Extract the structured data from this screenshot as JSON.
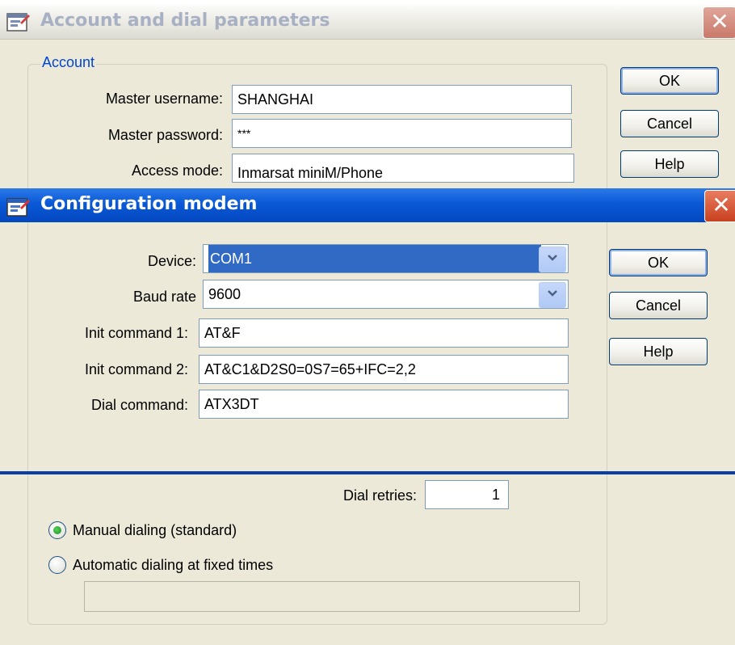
{
  "account_dialog": {
    "title": "Account and dial parameters",
    "close_glyph": "✕",
    "group_title": "Account",
    "master_username_label": "Master username:",
    "master_username_value": "SHANGHAI",
    "master_password_label": "Master password:",
    "master_password_value": "***",
    "access_mode_label": "Access mode:",
    "access_mode_value": "Inmarsat miniM/Phone",
    "ok_label": "OK",
    "cancel_label": "Cancel",
    "help_label": "Help",
    "dial_retries_label": "Dial retries:",
    "dial_retries_value": "1",
    "manual_dialing_label": "Manual dialing (standard)",
    "manual_dialing_selected": true,
    "automatic_dialing_label": "Automatic dialing at fixed times",
    "automatic_dialing_selected": false,
    "fixed_times_value": ""
  },
  "modem_dialog": {
    "title": "Configuration modem",
    "close_glyph": "✕",
    "device_label": "Device:",
    "device_value": "COM1",
    "baud_rate_label": "Baud rate",
    "baud_rate_value": "9600",
    "init1_label": "Init command 1:",
    "init1_value": "AT&F",
    "init2_label": "Init command 2:",
    "init2_value": "AT&C1&D2S0=0S7=65+IFC=2,2",
    "dial_command_label": "Dial command:",
    "dial_command_value": "ATX3DT",
    "ok_label": "OK",
    "cancel_label": "Cancel",
    "help_label": "Help"
  },
  "icons": [
    "window-icon",
    "close-icon",
    "chevron-down-icon",
    "radio-selected-icon",
    "radio-unselected-icon"
  ],
  "colors": {
    "titlebar_active": "#0a58d6",
    "titlebar_inactive": "#ecebe4",
    "group_title": "#0046d5",
    "selection": "#316ac5",
    "divider": "#0a3fa8"
  }
}
